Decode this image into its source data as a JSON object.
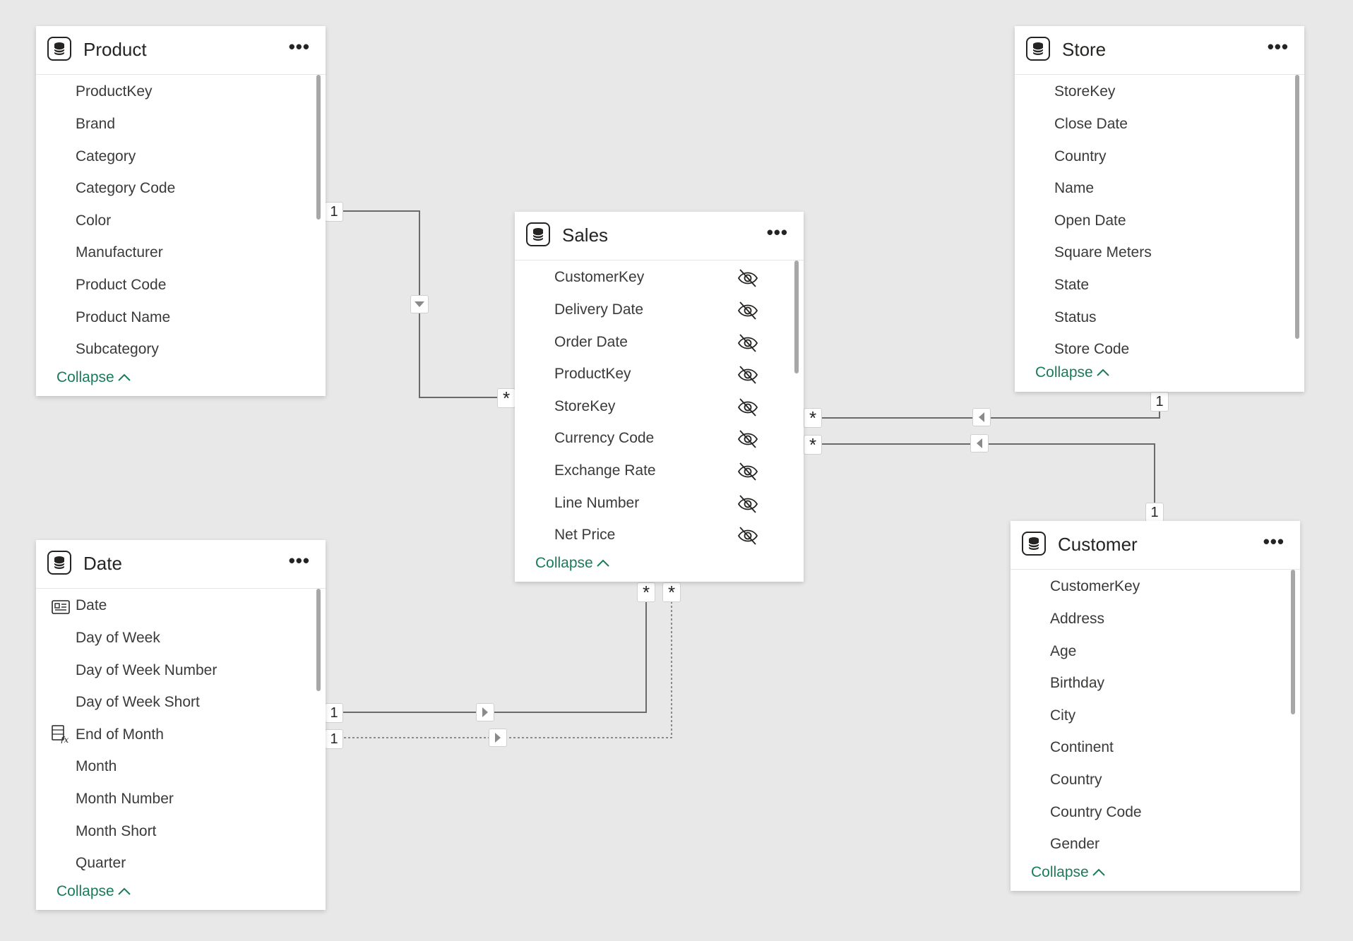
{
  "tables": {
    "product": {
      "title": "Product",
      "more": "•••",
      "collapse": "Collapse",
      "fields": [
        "ProductKey",
        "Brand",
        "Category",
        "Category Code",
        "Color",
        "Manufacturer",
        "Product Code",
        "Product Name",
        "Subcategory"
      ]
    },
    "store": {
      "title": "Store",
      "more": "•••",
      "collapse": "Collapse",
      "fields": [
        "StoreKey",
        "Close Date",
        "Country",
        "Name",
        "Open Date",
        "Square Meters",
        "State",
        "Status",
        "Store Code"
      ]
    },
    "sales": {
      "title": "Sales",
      "more": "•••",
      "collapse": "Collapse",
      "fields": [
        "CustomerKey",
        "Delivery Date",
        "Order Date",
        "ProductKey",
        "StoreKey",
        "Currency Code",
        "Exchange Rate",
        "Line Number",
        "Net Price"
      ]
    },
    "date": {
      "title": "Date",
      "more": "•••",
      "collapse": "Collapse",
      "fields": [
        "Date",
        "Day of Week",
        "Day of Week Number",
        "Day of Week Short",
        "End of Month",
        "Month",
        "Month Number",
        "Month Short",
        "Quarter"
      ]
    },
    "customer": {
      "title": "Customer",
      "more": "•••",
      "collapse": "Collapse",
      "fields": [
        "CustomerKey",
        "Address",
        "Age",
        "Birthday",
        "City",
        "Continent",
        "Country",
        "Country Code",
        "Gender"
      ]
    }
  },
  "relationships": {
    "one": "1",
    "many": "*"
  },
  "icons": {
    "table": "table-database-icon",
    "key": "date-key-icon",
    "calc": "calculated-column-icon",
    "hidden": "hidden-eye-icon"
  },
  "colors": {
    "accent": "#1a7a5c",
    "canvas": "#e8e8e8",
    "line": "#6a6a6a"
  }
}
